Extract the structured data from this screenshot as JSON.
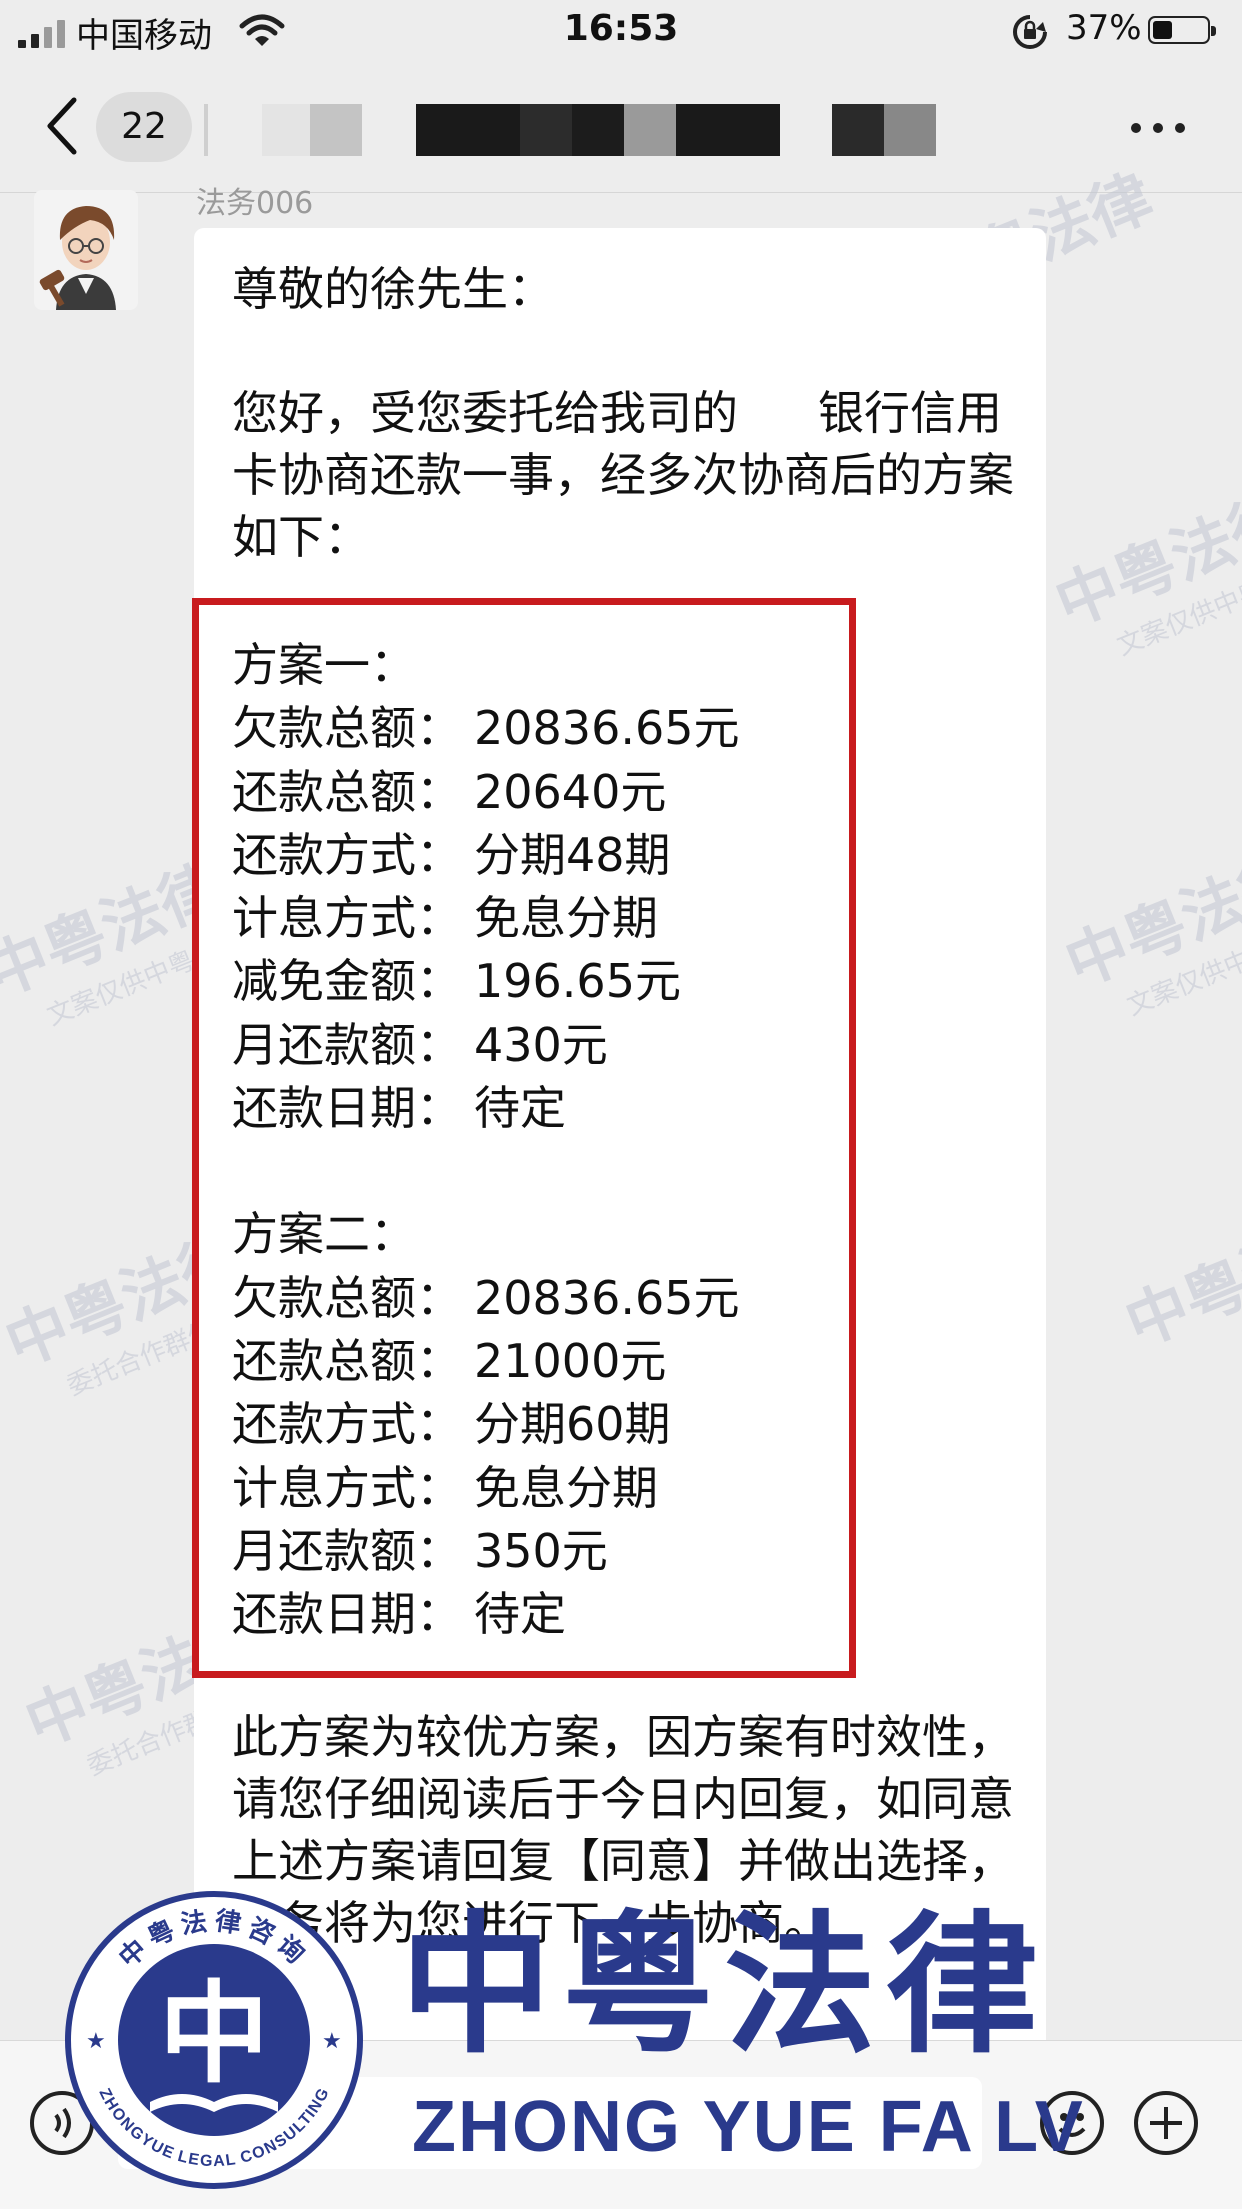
{
  "status_bar": {
    "carrier": "中国移动",
    "time": "16:53",
    "battery": "37%",
    "battery_level": 0.37
  },
  "nav": {
    "unread_count": "22"
  },
  "chat": {
    "sender_name": "法务006",
    "greeting": "尊敬的徐先生：",
    "intro_part1": "您好，受您委托给我司的",
    "intro_part2": "银行信用卡协商还款一事，经多次协商后的方案如下：",
    "plan1": {
      "title": "方案一：",
      "rows": [
        {
          "label": "欠款总额：",
          "value": "20836.65元"
        },
        {
          "label": "还款总额：",
          "value": "20640元"
        },
        {
          "label": "还款方式：",
          "value": "分期48期"
        },
        {
          "label": "计息方式：",
          "value": "免息分期"
        },
        {
          "label": "减免金额：",
          "value": "196.65元"
        },
        {
          "label": "月还款额：",
          "value": "430元"
        },
        {
          "label": "还款日期：",
          "value": "待定"
        }
      ]
    },
    "plan2": {
      "title": "方案二：",
      "rows": [
        {
          "label": "欠款总额：",
          "value": "20836.65元"
        },
        {
          "label": "还款总额：",
          "value": "21000元"
        },
        {
          "label": "还款方式：",
          "value": "分期60期"
        },
        {
          "label": "计息方式：",
          "value": "免息分期"
        },
        {
          "label": "月还款额：",
          "value": "350元"
        },
        {
          "label": "还款日期：",
          "value": "待定"
        }
      ]
    },
    "closing": "此方案为较优方案，因方案有时效性，请您仔细阅读后于今日内回复，如同意上述方案请回复【同意】并做出选择，法务将为您进行下一步协商。"
  },
  "logo": {
    "name": "中粤法律",
    "pinyin": "ZHONG YUE FA LV",
    "seal_text_top": "中粤法律咨询",
    "seal_text_bottom": "ZHONGYUE LEGAL CONSULTING",
    "seal_char": "中",
    "color": "#2a3a8c"
  },
  "watermark": {
    "name": "中粤法律",
    "line1": "文案仅供中粤内部使用",
    "line2": "委托合作群体多同多核实"
  },
  "colors": {
    "highlight_border": "#c81b1e",
    "background": "#ededed",
    "bubble": "#ffffff"
  }
}
